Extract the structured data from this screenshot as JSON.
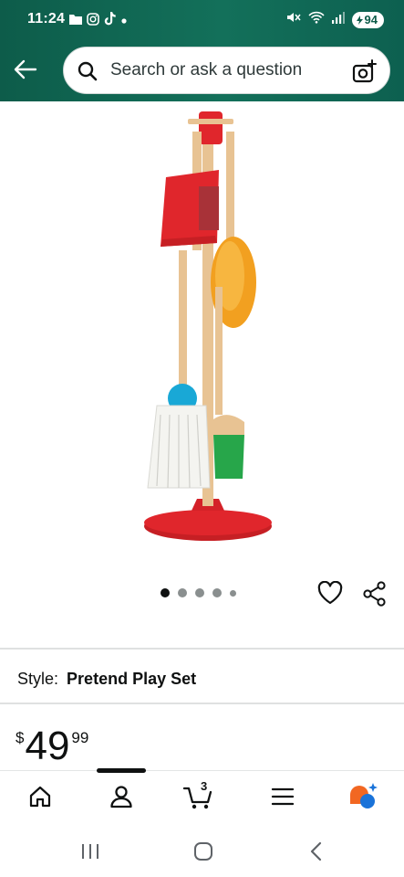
{
  "status_bar": {
    "time": "11:24",
    "battery": "94",
    "left_icons": [
      "folder-icon",
      "instagram-icon",
      "tiktok-icon",
      "dot-icon"
    ],
    "right_icons": [
      "mute-icon",
      "wifi-icon",
      "signal-icon",
      "battery-icon"
    ]
  },
  "header": {
    "search_placeholder": "Search or ask a question",
    "colors": {
      "header_bg": "#0d5c4a"
    }
  },
  "product": {
    "image_alt": "Cleaning play set stand",
    "carousel": {
      "count": 5,
      "active_index": 0
    },
    "style_label": "Style:",
    "style_value": "Pretend Play Set",
    "price": {
      "symbol": "$",
      "whole": "49",
      "fraction": "99"
    }
  },
  "bottom_nav": {
    "items": [
      "home-icon",
      "account-icon",
      "cart-icon",
      "menu-icon",
      "assistant-icon"
    ],
    "active": "account-icon",
    "cart_count": "3"
  },
  "system_nav": [
    "recents-button",
    "home-button",
    "back-button"
  ]
}
